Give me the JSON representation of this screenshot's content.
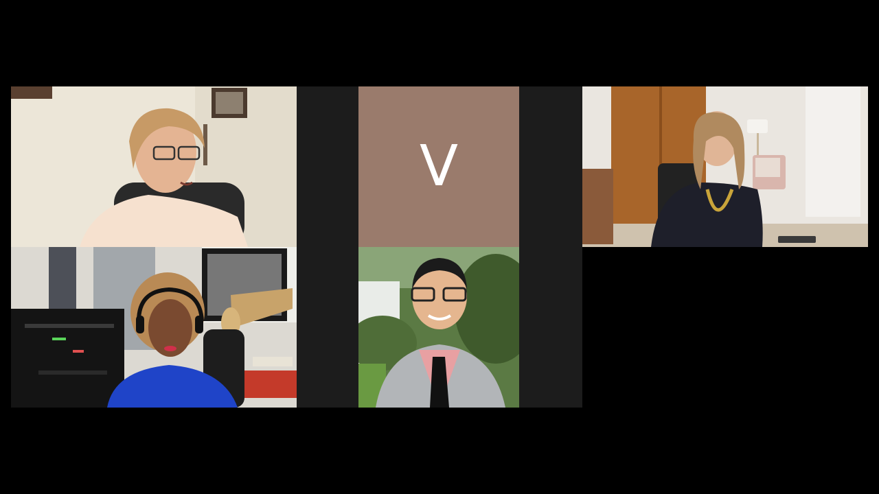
{
  "participants": [
    {
      "id": "p1",
      "kind": "video",
      "icon": "person-video"
    },
    {
      "id": "p2",
      "kind": "avatar",
      "initial": "V"
    },
    {
      "id": "p3",
      "kind": "video",
      "icon": "person-video"
    },
    {
      "id": "p4",
      "kind": "video",
      "icon": "person-video"
    },
    {
      "id": "p5",
      "kind": "video",
      "icon": "person-video"
    }
  ],
  "colors": {
    "background": "#000000",
    "empty_tile": "#1c1c1c",
    "avatar_bg": "#9a7b6c"
  }
}
